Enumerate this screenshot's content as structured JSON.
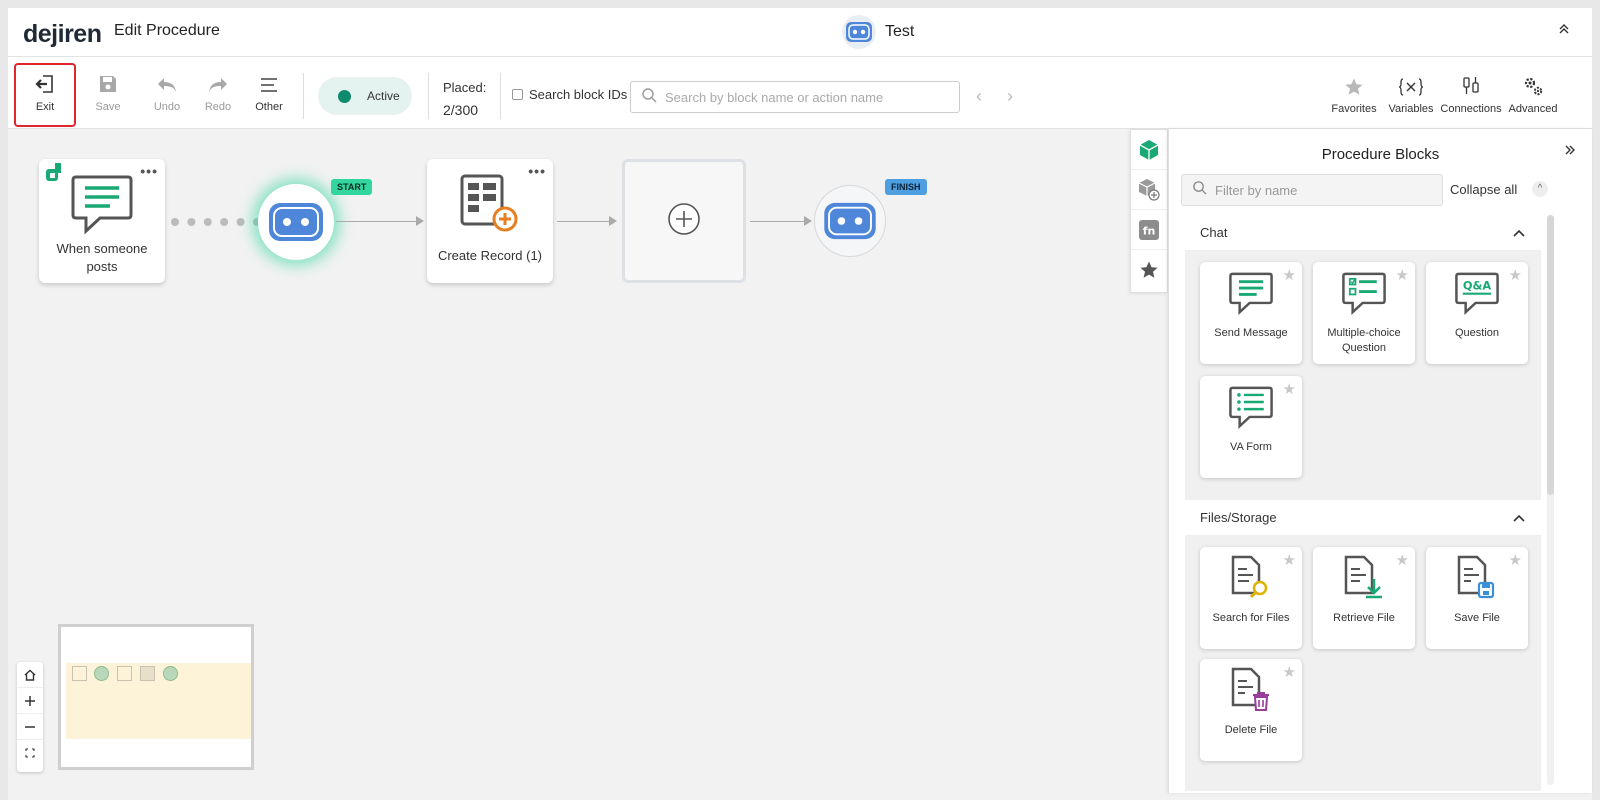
{
  "header": {
    "logo": "dejiren",
    "page_title": "Edit Procedure",
    "procedure_name": "Test"
  },
  "toolbar": {
    "exit": "Exit",
    "save": "Save",
    "undo": "Undo",
    "redo": "Redo",
    "other": "Other",
    "status": "Active",
    "placed_label": "Placed:",
    "placed_count": "2/300",
    "search_ids_label": "Search block IDs",
    "search_placeholder": "Search by block name or action name",
    "favorites": "Favorites",
    "variables": "Variables",
    "connections": "Connections",
    "advanced": "Advanced"
  },
  "canvas": {
    "trigger_label_1": "When someone",
    "trigger_label_2": "posts",
    "start_tag": "START",
    "finish_tag": "FINISH",
    "create_record_label": "Create Record (1)"
  },
  "panel": {
    "title": "Procedure Blocks",
    "filter_placeholder": "Filter by name",
    "collapse_all": "Collapse all",
    "sections": [
      {
        "title": "Chat",
        "blocks": [
          "Send Message",
          "Multiple-choice Question",
          "Question",
          "VA Form"
        ]
      },
      {
        "title": "Files/Storage",
        "blocks": [
          "Search for Files",
          "Retrieve File",
          "Save File",
          "Delete File"
        ]
      }
    ]
  },
  "colors": {
    "accent_green": "#0e8a6c",
    "start_tag": "#33d69f",
    "finish_tag": "#4e9fe0",
    "bot_blue": "#4e86d9",
    "exit_highlight": "#e0262d"
  }
}
